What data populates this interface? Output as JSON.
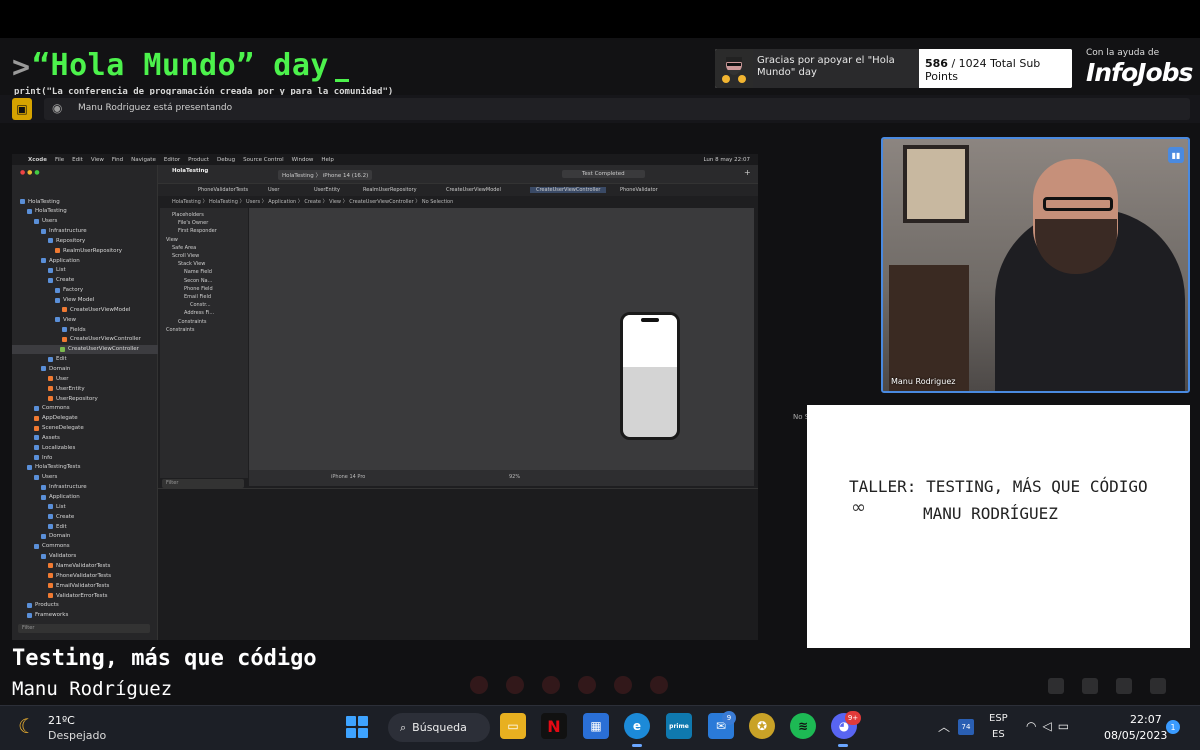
{
  "stream": {
    "prompt": ">",
    "title": "“Hola Mundo” day",
    "subtitle": "print(\"La conferencia de programación creada por y para la comunidad\")",
    "sub_message": "Gracias por apoyar el \"Hola Mundo\" day",
    "sub_current": "586",
    "sub_rest": " / 1024 Total Sub Points",
    "sponsor_prefix": "Con la ayuda de",
    "sponsor_name": "InfoJobs",
    "lower_title": "Testing, más que código",
    "lower_sub": "Manu Rodríguez"
  },
  "teams": {
    "presenting_text": "Manu Rodriguez está presentando"
  },
  "xcode": {
    "app": "Xcode",
    "menus": [
      "File",
      "Edit",
      "View",
      "Find",
      "Navigate",
      "Editor",
      "Product",
      "Debug",
      "Source Control",
      "Window",
      "Help"
    ],
    "mac_clock": "Lun 8 may 22:07",
    "project": "HolaTesting",
    "scheme": "HolaTesting 〉 iPhone 14 (16.2)",
    "status": "Test Completed",
    "tabs": [
      "PhoneValidatorTests",
      "User",
      "UserEntity",
      "RealmUserRepository",
      "CreateUserViewModel",
      "CreateUserViewController",
      "PhoneValidator"
    ],
    "breadcrumb": "HolaTesting 〉 HolaTesting 〉 Users 〉 Application 〉 Create 〉 View 〉 CreateUserViewController 〉 No Selection",
    "navigator": [
      {
        "label": "HolaTesting",
        "indent": 0,
        "icon": "blue"
      },
      {
        "label": "HolaTesting",
        "indent": 1,
        "icon": "blue"
      },
      {
        "label": "Users",
        "indent": 2,
        "icon": "blue"
      },
      {
        "label": "Infrastructure",
        "indent": 3,
        "icon": "blue"
      },
      {
        "label": "Repository",
        "indent": 4,
        "icon": "blue"
      },
      {
        "label": "RealmUserRepository",
        "indent": 5,
        "icon": "sw"
      },
      {
        "label": "Application",
        "indent": 3,
        "icon": "blue"
      },
      {
        "label": "List",
        "indent": 4,
        "icon": "blue"
      },
      {
        "label": "Create",
        "indent": 4,
        "icon": "blue"
      },
      {
        "label": "Factory",
        "indent": 5,
        "icon": "blue"
      },
      {
        "label": "View Model",
        "indent": 5,
        "icon": "blue"
      },
      {
        "label": "CreateUserViewModel",
        "indent": 6,
        "icon": "sw"
      },
      {
        "label": "View",
        "indent": 5,
        "icon": "blue"
      },
      {
        "label": "Fields",
        "indent": 6,
        "icon": "blue"
      },
      {
        "label": "CreateUserViewController",
        "indent": 6,
        "icon": "sw"
      },
      {
        "label": "CreateUserViewController",
        "indent": 6,
        "icon": "gr"
      },
      {
        "label": "Edit",
        "indent": 4,
        "icon": "blue"
      },
      {
        "label": "Domain",
        "indent": 3,
        "icon": "blue"
      },
      {
        "label": "User",
        "indent": 4,
        "icon": "sw"
      },
      {
        "label": "UserEntity",
        "indent": 4,
        "icon": "sw"
      },
      {
        "label": "UserRepository",
        "indent": 4,
        "icon": "sw"
      },
      {
        "label": "Commons",
        "indent": 2,
        "icon": "blue"
      },
      {
        "label": "AppDelegate",
        "indent": 2,
        "icon": "sw"
      },
      {
        "label": "SceneDelegate",
        "indent": 2,
        "icon": "sw"
      },
      {
        "label": "Assets",
        "indent": 2,
        "icon": "blue"
      },
      {
        "label": "Localizables",
        "indent": 2,
        "icon": "blue"
      },
      {
        "label": "Info",
        "indent": 2,
        "icon": "blue"
      },
      {
        "label": "HolaTestingTests",
        "indent": 1,
        "icon": "blue"
      },
      {
        "label": "Users",
        "indent": 2,
        "icon": "blue"
      },
      {
        "label": "Infrastructure",
        "indent": 3,
        "icon": "blue"
      },
      {
        "label": "Application",
        "indent": 3,
        "icon": "blue"
      },
      {
        "label": "List",
        "indent": 4,
        "icon": "blue"
      },
      {
        "label": "Create",
        "indent": 4,
        "icon": "blue"
      },
      {
        "label": "Edit",
        "indent": 4,
        "icon": "blue"
      },
      {
        "label": "Domain",
        "indent": 3,
        "icon": "blue"
      },
      {
        "label": "Commons",
        "indent": 2,
        "icon": "blue"
      },
      {
        "label": "Validators",
        "indent": 3,
        "icon": "blue"
      },
      {
        "label": "NameValidatorTests",
        "indent": 4,
        "icon": "sw"
      },
      {
        "label": "PhoneValidatorTests",
        "indent": 4,
        "icon": "sw"
      },
      {
        "label": "EmailValidatorTests",
        "indent": 4,
        "icon": "sw"
      },
      {
        "label": "ValidatorErrorTests",
        "indent": 4,
        "icon": "sw"
      },
      {
        "label": "Products",
        "indent": 1,
        "icon": "blue"
      },
      {
        "label": "Frameworks",
        "indent": 1,
        "icon": "blue"
      }
    ],
    "outline": [
      "Placeholders",
      "File's Owner",
      "First Responder",
      "View",
      "Safe Area",
      "Scroll View",
      "Stack View",
      "Name Field",
      "Secon Na...",
      "Phone Field",
      "Email Field",
      "Constr...",
      "Address Fi...",
      "Constraints",
      "Constraints"
    ],
    "device": "iPhone 14 Pro",
    "zoom": "92%",
    "filter_placeholder": "Filter",
    "no_selection": "No S"
  },
  "cam": {
    "name": "Manu Rodriguez"
  },
  "board": {
    "line1": "TALLER: TESTING, MÁS QUE CÓDIGO",
    "line2": "MANU RODRÍGUEZ"
  },
  "taskbar": {
    "temp": "21ºC",
    "weather": "Despejado",
    "search": "Búsqueda",
    "badge_store": "9",
    "badge_discord": "9+",
    "tray_num": "74",
    "lang1": "ESP",
    "lang2": "ES",
    "time": "22:07",
    "date": "08/05/2023",
    "notifications": "1"
  },
  "colors": {
    "accent_green": "#4cf24c",
    "teams_yellow": "#d6a300",
    "cam_border": "#4a8ae0"
  }
}
